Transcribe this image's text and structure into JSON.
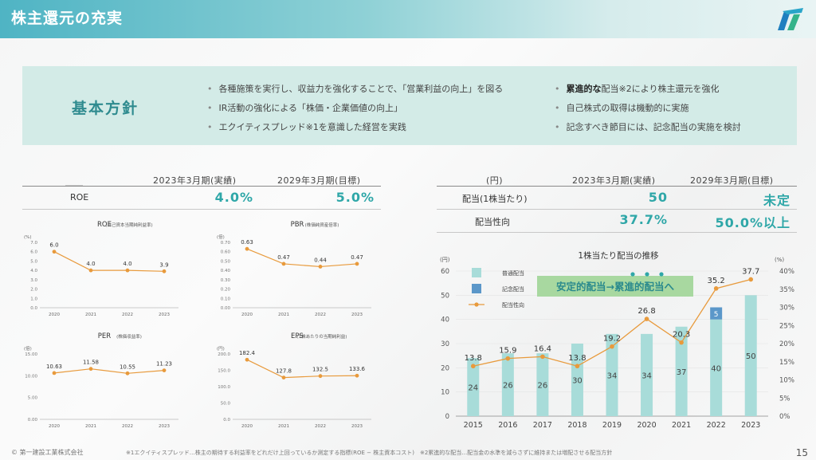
{
  "header": {
    "title": "株主還元の充実"
  },
  "policy": {
    "title": "基本方針",
    "left_items": [
      "各種施策を実行し、収益力を強化することで、「営業利益の向上」を図る",
      "IR活動の強化による「株価・企業価値の向上」",
      "エクイティスプレッド※1を意識した経営を実践"
    ],
    "right_items": [
      {
        "bold": "累進的な",
        "rest": "配当※2により株主還元を強化"
      },
      {
        "bold": "",
        "rest": "自己株式の取得は機動的に実施"
      },
      {
        "bold": "",
        "rest": "記念すべき節目には、記念配当の実施を検討"
      }
    ]
  },
  "left_table": {
    "col1": "2023年3月期(実績)",
    "col2": "2029年3月期(目標)",
    "row_label": "ROE",
    "val1": "4.0%",
    "val2": "5.0%"
  },
  "right_table": {
    "unit": "(円)",
    "col1": "2023年3月期(実績)",
    "col2": "2029年3月期(目標)",
    "rows": [
      {
        "label": "配当(1株当たり)",
        "val1": "50",
        "val2": "未定"
      },
      {
        "label": "配当性向",
        "val1": "37.7%",
        "val2": "50.0%以上"
      }
    ]
  },
  "colors": {
    "accent": "#2fa7a8",
    "line": "#e89a3c",
    "bar": "#a8dcd9",
    "bar_commemorative": "#5b97c9",
    "banner": "#a8d8a0"
  },
  "chart_data": [
    {
      "type": "line",
      "title": "ROE",
      "subtitle": "(自己資本当期純利益率)",
      "unit": "(%)",
      "x": [
        "2020",
        "2021",
        "2022",
        "2023"
      ],
      "values": [
        6.0,
        4.0,
        4.0,
        3.9
      ],
      "labels": [
        "6.0",
        "4.0",
        "4.0",
        "3.9"
      ],
      "ylim": [
        0,
        7
      ],
      "yticks": [
        "0.0",
        "1.0",
        "2.0",
        "3.0",
        "4.0",
        "5.0",
        "6.0",
        "7.0"
      ]
    },
    {
      "type": "line",
      "title": "PBR",
      "subtitle": "(株価純資産倍率)",
      "unit": "(倍)",
      "x": [
        "2020",
        "2021",
        "2022",
        "2023"
      ],
      "values": [
        0.63,
        0.47,
        0.44,
        0.47
      ],
      "labels": [
        "0.63",
        "0.47",
        "0.44",
        "0.47"
      ],
      "ylim": [
        0,
        0.7
      ],
      "yticks": [
        "0.00",
        "0.10",
        "0.20",
        "0.30",
        "0.40",
        "0.50",
        "0.60",
        "0.70"
      ]
    },
    {
      "type": "line",
      "title": "PER",
      "subtitle": "(株価収益率)",
      "unit": "(倍)",
      "x": [
        "2020",
        "2021",
        "2022",
        "2023"
      ],
      "values": [
        10.63,
        11.58,
        10.55,
        11.23
      ],
      "labels": [
        "10.63",
        "11.58",
        "10.55",
        "11.23"
      ],
      "ylim": [
        0,
        15
      ],
      "yticks": [
        "0.00",
        "5.00",
        "10.00",
        "15.00"
      ]
    },
    {
      "type": "line",
      "title": "EPS",
      "subtitle": "(1株あたりの当期純利益)",
      "unit": "(円)",
      "x": [
        "2020",
        "2021",
        "2022",
        "2023"
      ],
      "values": [
        182.4,
        127.8,
        132.5,
        133.6
      ],
      "labels": [
        "182.4",
        "127.8",
        "132.5",
        "133.6"
      ],
      "ylim": [
        0,
        200
      ],
      "yticks": [
        "0.0",
        "50.0",
        "100.0",
        "150.0",
        "200.0"
      ]
    },
    {
      "type": "bar",
      "title": "1株当たり配当の推移",
      "y_left_unit": "(円)",
      "y_right_unit": "(%)",
      "categories": [
        "2015",
        "2016",
        "2017",
        "2018",
        "2019",
        "2020",
        "2021",
        "2022",
        "2023"
      ],
      "series": [
        {
          "name": "普通配当",
          "values": [
            24,
            26,
            26,
            30,
            34,
            34,
            37,
            40,
            50
          ]
        },
        {
          "name": "記念配当",
          "values": [
            0,
            0,
            0,
            0,
            0,
            0,
            0,
            5,
            0
          ]
        },
        {
          "name": "配当性向",
          "values": [
            13.8,
            15.9,
            16.4,
            13.8,
            19.2,
            26.8,
            20.3,
            35.2,
            37.7
          ]
        }
      ],
      "payout_labels": [
        "13.8",
        "15.9",
        "16.4",
        "13.8",
        "19.2",
        "26.8",
        "20.3",
        "35.2",
        "37.7"
      ],
      "ylim_left": [
        0,
        60
      ],
      "ylim_right": [
        0,
        40
      ],
      "yticks_left": [
        "0",
        "10",
        "20",
        "30",
        "40",
        "50",
        "60"
      ],
      "yticks_right": [
        "0%",
        "5%",
        "10%",
        "15%",
        "20%",
        "25%",
        "30%",
        "35%",
        "40%"
      ],
      "banner": "安定的配当→累進的配当へ"
    }
  ],
  "footer": {
    "copyright": "© 第一建設工業株式会社",
    "note": "※1エクイティスプレッド…株主の期待する利益率をどれだけ上回っているか測定する指標(ROE − 株主資本コスト)　※2累進的な配当…配当金の水準を減らさずに維持または増配させる配当方針",
    "page": "15"
  }
}
